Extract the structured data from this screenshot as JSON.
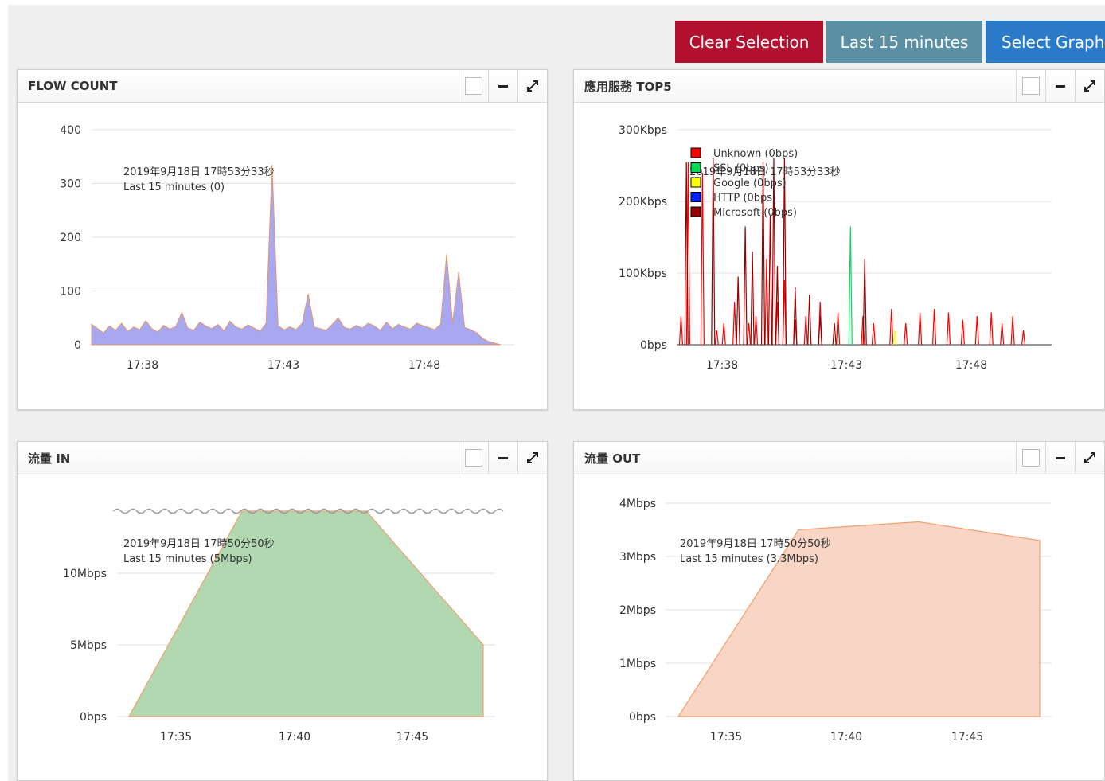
{
  "toolbar": {
    "clear_label": "Clear Selection",
    "range_label": "Last 15 minutes",
    "select_label": "Select Graph"
  },
  "panels": {
    "flow": {
      "title": "FLOW COUNT",
      "tip_time": "2019年9月18日 17時53分33秒",
      "tip_value": "Last 15 minutes (0)",
      "y_ticks": [
        "400",
        "300",
        "200",
        "100",
        "0"
      ],
      "x_ticks": [
        "17:38",
        "17:43",
        "17:48"
      ]
    },
    "apps": {
      "title": "應用服務 TOP5",
      "tip_time": "2019年9月18日 17時53分33秒",
      "legend": [
        "Unknown (0bps)",
        "SSL (0bps)",
        "Google (0bps)",
        "HTTP (0bps)",
        "Microsoft (0bps)"
      ],
      "legend_colors": [
        "#ff0000",
        "#00dd55",
        "#ffff00",
        "#0022ff",
        "#990000"
      ],
      "y_ticks": [
        "300Kbps",
        "200Kbps",
        "100Kbps",
        "0bps"
      ],
      "x_ticks": [
        "17:38",
        "17:43",
        "17:48"
      ]
    },
    "traffic_in": {
      "title": "流量 IN",
      "tip_time": "2019年9月18日 17時50分50秒",
      "tip_value": "Last 15 minutes (5Mbps)",
      "y_ticks": [
        "10Mbps",
        "5Mbps",
        "0bps"
      ],
      "x_ticks": [
        "17:35",
        "17:40",
        "17:45"
      ]
    },
    "traffic_out": {
      "title": "流量 OUT",
      "tip_time": "2019年9月18日 17時50分50秒",
      "tip_value": "Last 15 minutes (3.3Mbps)",
      "y_ticks": [
        "4Mbps",
        "3Mbps",
        "2Mbps",
        "1Mbps",
        "0bps"
      ],
      "x_ticks": [
        "17:35",
        "17:40",
        "17:45"
      ]
    }
  },
  "colors": {
    "clear_button": "#b2102f",
    "range_button": "#5b8fa3",
    "select_button": "#2a7ac8",
    "flow_fill": "#a8a8f0",
    "flow_line": "#e8956a",
    "in_fill": "#b2d8b2",
    "out_fill": "#f8d5c5",
    "area_line": "#f0a070"
  },
  "chart_data": [
    {
      "type": "area",
      "title": "FLOW COUNT",
      "x_ticks": [
        "17:38",
        "17:43",
        "17:48"
      ],
      "ylim": [
        0,
        400
      ],
      "series": [
        {
          "values": [
            38,
            30,
            22,
            35,
            27,
            40,
            25,
            33,
            28,
            45,
            30,
            24,
            36,
            29,
            34,
            60,
            31,
            27,
            42,
            35,
            30,
            38,
            26,
            44,
            33,
            29,
            37,
            31,
            25,
            40,
            335,
            35,
            28,
            33,
            28,
            40,
            95,
            33,
            30,
            27,
            38,
            50,
            32,
            29,
            36,
            31,
            40,
            35,
            27,
            42,
            30,
            38,
            33,
            29,
            40,
            36,
            32,
            28,
            38,
            168,
            40,
            135,
            32,
            28,
            22,
            12,
            6,
            3,
            0
          ]
        }
      ],
      "grid": true
    },
    {
      "type": "line",
      "title": "應用服務 TOP5",
      "x_ticks": [
        "17:38",
        "17:43",
        "17:48"
      ],
      "ylim": [
        0,
        300
      ],
      "y_unit": "Kbps",
      "series": [
        {
          "name": "Unknown",
          "peaks": [
            [
              0.01,
              40
            ],
            [
              0.03,
              255
            ],
            [
              0.07,
              240
            ],
            [
              0.11,
              20
            ],
            [
              0.13,
              30
            ],
            [
              0.16,
              60
            ],
            [
              0.2,
              30
            ],
            [
              0.22,
              40
            ],
            [
              0.25,
              120
            ],
            [
              0.28,
              60
            ],
            [
              0.3,
              90
            ],
            [
              0.33,
              35
            ],
            [
              0.36,
              40
            ],
            [
              0.4,
              60
            ],
            [
              0.45,
              45
            ],
            [
              0.52,
              40
            ],
            [
              0.55,
              30
            ],
            [
              0.6,
              50
            ],
            [
              0.64,
              30
            ],
            [
              0.68,
              45
            ],
            [
              0.72,
              50
            ],
            [
              0.76,
              45
            ],
            [
              0.8,
              35
            ],
            [
              0.84,
              40
            ],
            [
              0.88,
              45
            ],
            [
              0.91,
              30
            ],
            [
              0.94,
              40
            ],
            [
              0.97,
              20
            ]
          ]
        },
        {
          "name": "SSL",
          "peaks": [
            [
              0.485,
              165
            ]
          ]
        },
        {
          "name": "Google",
          "peaks": [
            [
              0.61,
              20
            ]
          ]
        },
        {
          "name": "HTTP",
          "peaks": []
        },
        {
          "name": "Microsoft",
          "peaks": [
            [
              0.025,
              255
            ],
            [
              0.1,
              260
            ],
            [
              0.17,
              95
            ],
            [
              0.19,
              165
            ],
            [
              0.21,
              130
            ],
            [
              0.24,
              255
            ],
            [
              0.26,
              180
            ],
            [
              0.27,
              260
            ],
            [
              0.28,
              110
            ],
            [
              0.3,
              260
            ],
            [
              0.33,
              80
            ],
            [
              0.37,
              70
            ],
            [
              0.4,
              40
            ],
            [
              0.44,
              30
            ],
            [
              0.525,
              120
            ]
          ]
        }
      ],
      "grid": true
    },
    {
      "type": "area",
      "title": "流量 IN",
      "x_ticks": [
        "17:35",
        "17:40",
        "17:45"
      ],
      "y_ticks": [
        "0bps",
        "5Mbps",
        "10Mbps"
      ],
      "series": [
        {
          "x": [
            "17:33",
            "17:38",
            "17:43",
            "17:48"
          ],
          "values_mbps": [
            0,
            14,
            14,
            5
          ]
        }
      ],
      "grid": true
    },
    {
      "type": "area",
      "title": "流量 OUT",
      "x_ticks": [
        "17:35",
        "17:40",
        "17:45"
      ],
      "ylim": [
        0,
        4
      ],
      "y_unit": "Mbps",
      "series": [
        {
          "x": [
            "17:33",
            "17:38",
            "17:43",
            "17:48"
          ],
          "values_mbps": [
            0,
            3.5,
            3.65,
            3.3
          ]
        }
      ],
      "grid": true
    }
  ]
}
